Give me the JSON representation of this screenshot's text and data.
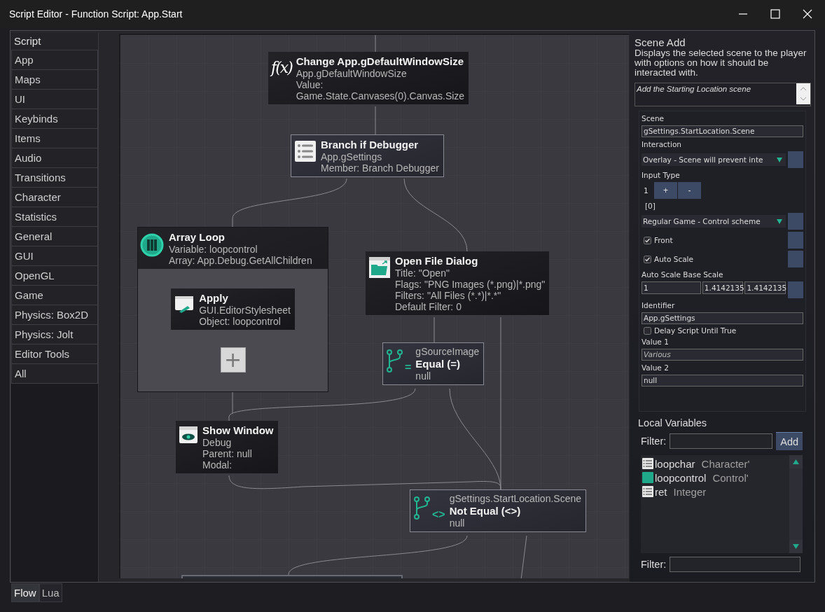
{
  "window": {
    "title": "Script Editor - Function Script: App.Start"
  },
  "sidebar": {
    "header": "Script",
    "items": [
      {
        "label": "App"
      },
      {
        "label": "Maps"
      },
      {
        "label": "UI"
      },
      {
        "label": "Keybinds"
      },
      {
        "label": "Items"
      },
      {
        "label": "Audio"
      },
      {
        "label": "Transitions"
      },
      {
        "label": "Character"
      },
      {
        "label": "Statistics"
      },
      {
        "label": "General"
      },
      {
        "label": "GUI"
      },
      {
        "label": "OpenGL"
      },
      {
        "label": "Game"
      },
      {
        "label": "Physics: Box2D"
      },
      {
        "label": "Physics: Jolt"
      },
      {
        "label": "Editor Tools"
      },
      {
        "label": "All"
      }
    ]
  },
  "nodes": [
    {
      "kind": "function",
      "glyph": "f(x)",
      "title": "Change App.gDefaultWindowSize",
      "lines": [
        "App.gDefaultWindowSize",
        "Value:",
        "Game.State.Canvases(0).Canvas.Size"
      ]
    },
    {
      "kind": "branch",
      "title": "Branch if Debugger",
      "lines": [
        "App.gSettings",
        "Member:  Branch Debugger"
      ]
    },
    {
      "kind": "loop",
      "title": "Array Loop",
      "lines": [
        "Variable: loopcontrol",
        "Array: App.Debug.GetAllChildren"
      ],
      "add_label": "+",
      "children": [
        {
          "kind": "apply",
          "title": "Apply",
          "lines": [
            "GUI.EditorStylesheet",
            "Object: loopcontrol"
          ]
        }
      ]
    },
    {
      "kind": "dialog",
      "title": "Open File Dialog",
      "lines": [
        "Title: \"Open\"",
        "Flags: \"PNG Images (*.png)|*.png\"",
        "Filters: \"All Files (*.*)|*.*\"",
        "Default Filter: 0"
      ]
    },
    {
      "kind": "condition",
      "op": "=",
      "subject": "gSourceImage",
      "title": "Equal (=)",
      "lines": [
        "null"
      ]
    },
    {
      "kind": "window",
      "title": "Show Window",
      "lines": [
        "Debug",
        "Parent: null",
        "Modal:"
      ]
    },
    {
      "kind": "condition",
      "op": "<>",
      "subject": "gSettings.StartLocation.Scene",
      "title": "Not Equal (<>)",
      "lines": [
        "null"
      ]
    }
  ],
  "inspector": {
    "title": "Scene Add",
    "description": "Displays the selected scene to the player with options on how it should be interacted with.",
    "comment": "Add the Starting Location scene",
    "properties": [
      {
        "kind": "label",
        "text": "Scene"
      },
      {
        "kind": "field",
        "value": "gSettings.StartLocation.Scene",
        "mixed": false
      },
      {
        "kind": "label",
        "text": "Interaction"
      },
      {
        "kind": "dropdown",
        "value": "Overlay - Scene will prevent inte"
      },
      {
        "kind": "label",
        "text": "Input Type"
      },
      {
        "kind": "stepper",
        "value": "1",
        "plus": "+",
        "minus": "-"
      },
      {
        "kind": "index",
        "text": "[0]"
      },
      {
        "kind": "dropdown",
        "value": "Regular Game - Control scheme"
      },
      {
        "kind": "checkbox",
        "label": "Front",
        "checked": true,
        "side_button": true
      },
      {
        "kind": "checkbox",
        "label": "Auto Scale",
        "checked": true,
        "side_button": true
      },
      {
        "kind": "label",
        "text": "Auto Scale Base Scale"
      },
      {
        "kind": "fields",
        "values": [
          "1",
          "1.4142135",
          "1.4142135"
        ]
      },
      {
        "kind": "label",
        "text": "Identifier"
      },
      {
        "kind": "field",
        "value": "App.gSettings",
        "mixed": false
      },
      {
        "kind": "checkbox",
        "label": "Delay Script Until True",
        "checked": false,
        "side_button": false
      },
      {
        "kind": "label",
        "text": "Value 1"
      },
      {
        "kind": "field",
        "value": "Various",
        "mixed": true
      },
      {
        "kind": "label",
        "text": "Value 2"
      },
      {
        "kind": "field",
        "value": "null",
        "mixed": false
      }
    ]
  },
  "local_variables": {
    "title": "Local Variables",
    "filter_label": "Filter:",
    "add_button": "Add",
    "items": [
      {
        "name": "loopchar",
        "type": "Character'",
        "kind": "record"
      },
      {
        "name": "loopcontrol",
        "type": "Control'",
        "kind": "control"
      },
      {
        "name": "ret",
        "type": "Integer",
        "kind": "record"
      }
    ],
    "bottom_filter_label": "Filter:"
  },
  "bottom_tabs": [
    {
      "label": "Flow",
      "selected": true
    },
    {
      "label": "Lua",
      "selected": false
    }
  ]
}
